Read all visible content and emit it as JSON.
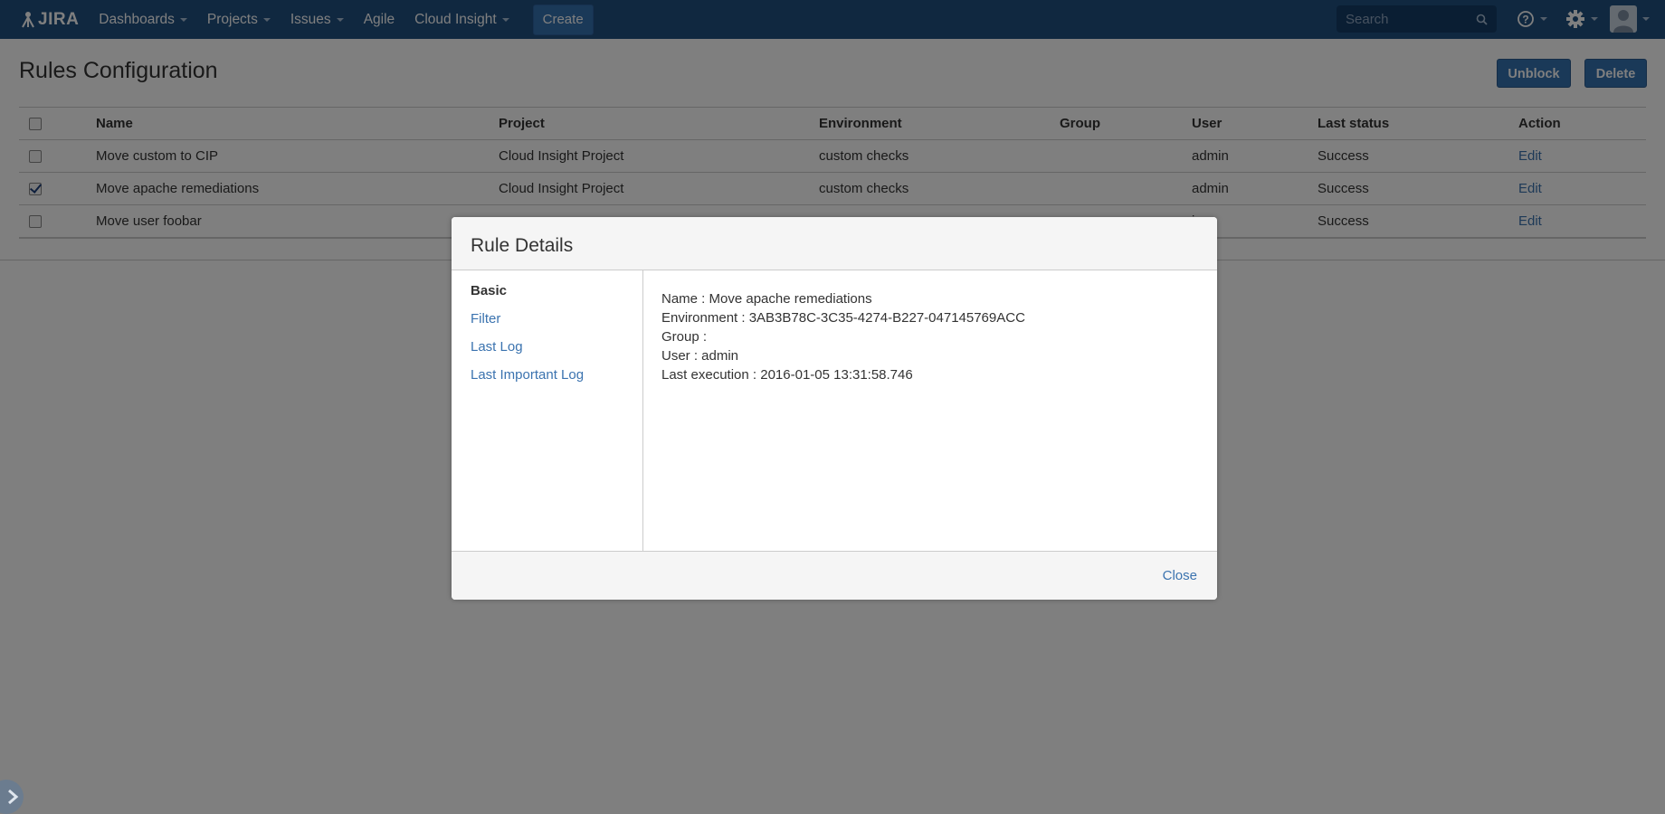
{
  "nav": {
    "logo_text": "JIRA",
    "items": [
      {
        "label": "Dashboards",
        "dropdown": true
      },
      {
        "label": "Projects",
        "dropdown": true
      },
      {
        "label": "Issues",
        "dropdown": true
      },
      {
        "label": "Agile",
        "dropdown": false
      },
      {
        "label": "Cloud Insight",
        "dropdown": true
      }
    ],
    "create_label": "Create",
    "search_placeholder": "Search",
    "icons": [
      "help-icon",
      "gear-icon",
      "user-avatar-icon",
      "search-icon"
    ]
  },
  "page": {
    "title": "Rules Configuration",
    "unblock_label": "Unblock",
    "delete_label": "Delete"
  },
  "table": {
    "headers": [
      "Name",
      "Project",
      "Environment",
      "Group",
      "User",
      "Last status",
      "Action"
    ],
    "rows": [
      {
        "checked": false,
        "name": "Move custom to CIP",
        "project": "Cloud Insight Project",
        "environment": "custom checks",
        "group": "",
        "user": "admin",
        "status": "Success",
        "action": "Edit"
      },
      {
        "checked": true,
        "name": "Move apache remediations",
        "project": "Cloud Insight Project",
        "environment": "custom checks",
        "group": "",
        "user": "admin",
        "status": "Success",
        "action": "Edit"
      },
      {
        "checked": false,
        "name": "Move user foobar",
        "project": "",
        "environment": "",
        "group": "",
        "user": "in",
        "status": "Success",
        "action": "Edit"
      }
    ]
  },
  "dialog": {
    "title": "Rule Details",
    "nav": [
      "Basic",
      "Filter",
      "Last Log",
      "Last Important Log"
    ],
    "details": [
      "Name : Move apache remediations",
      "Environment : 3AB3B78C-3C35-4274-B227-047145769ACC",
      "Group :",
      "User : admin",
      "Last execution : 2016-01-05 13:31:58.746"
    ],
    "close_label": "Close"
  },
  "colors": {
    "header_bg": "#205081",
    "primary_button": "#3572b0",
    "link": "#3b73af",
    "overlay": "rgba(0,0,0,0.5)"
  }
}
